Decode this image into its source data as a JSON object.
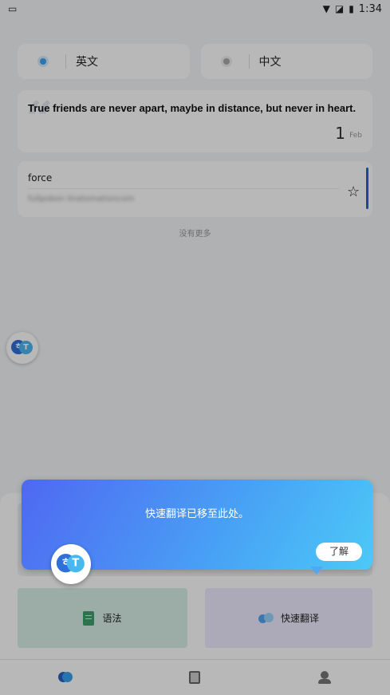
{
  "status_bar": {
    "time": "1:34"
  },
  "languages": {
    "source": "英文",
    "target": "中文"
  },
  "quote": {
    "text": "True friends are never apart, maybe in distance, but never in heart.",
    "day": "1",
    "month": "Feb"
  },
  "word": {
    "title": "force",
    "subtitle": "fullpoken linatomationcom"
  },
  "list": {
    "no_more": "没有更多"
  },
  "float_button": {
    "label_a": "ㅎ",
    "label_b": "T"
  },
  "tools": {
    "grammar": "语法",
    "quick_translate": "快速翻译"
  },
  "tooltip": {
    "message": "快速翻译已移至此处。",
    "ok": "了解"
  },
  "colors": {
    "accent": "#2d5fd8",
    "tooltip_start": "#4f68f2",
    "tooltip_end": "#4cc9f6",
    "grammar_bg": "#d9efe6",
    "quick_bg": "#efeaff"
  }
}
